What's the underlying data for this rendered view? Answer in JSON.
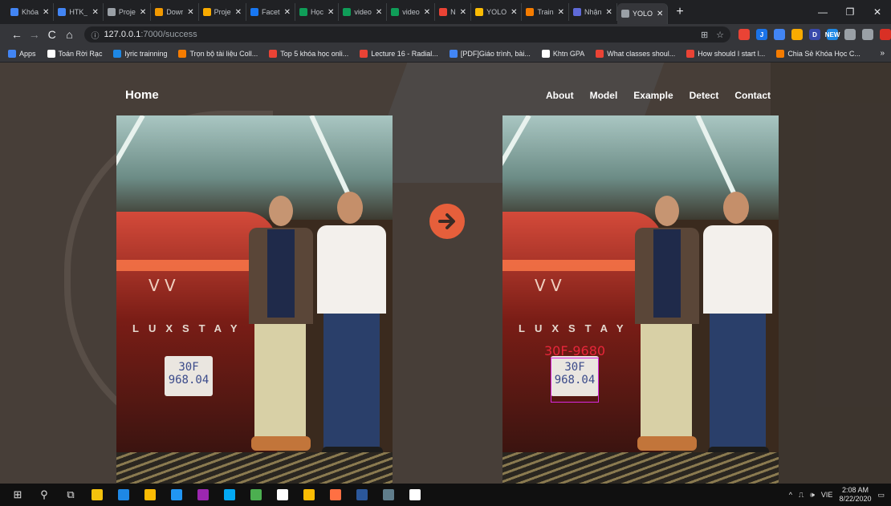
{
  "browser": {
    "tabs": [
      {
        "label": "Khóa",
        "color": "#4285f4"
      },
      {
        "label": "HTK_",
        "color": "#4285f4"
      },
      {
        "label": "Proje",
        "color": "#9aa0a6"
      },
      {
        "label": "Dowr",
        "color": "#f29900"
      },
      {
        "label": "Proje",
        "color": "#f9ab00"
      },
      {
        "label": "Facet",
        "color": "#1877f2"
      },
      {
        "label": "Học",
        "color": "#0f9d58"
      },
      {
        "label": "video",
        "color": "#0f9d58"
      },
      {
        "label": "video",
        "color": "#0f9d58"
      },
      {
        "label": "N",
        "color": "#ea4335"
      },
      {
        "label": "YOLO",
        "color": "#fbbc04"
      },
      {
        "label": "Train",
        "color": "#f57c00"
      },
      {
        "label": "Nhận",
        "color": "#5f6ad8"
      },
      {
        "label": "YOLO",
        "color": "#9aa0a6",
        "active": true
      }
    ],
    "new_tab": "+",
    "window_controls": {
      "minimize": "—",
      "maximize": "❐",
      "close": "✕"
    },
    "nav": {
      "back": "←",
      "forward": "→",
      "reload": "C",
      "home": "⌂"
    },
    "address": {
      "info_icon": "ⓘ",
      "host": "127.0.0.1",
      "path": ":7000/success"
    },
    "omni_icons": {
      "translate": "⊞",
      "bookmark_star": "☆"
    },
    "extensions": [
      {
        "label": "",
        "color": "#ea4335"
      },
      {
        "label": "J",
        "color": "#1a73e8"
      },
      {
        "label": "",
        "color": "#4285f4"
      },
      {
        "label": "",
        "color": "#f9ab00"
      },
      {
        "label": "D",
        "color": "#3949ab"
      },
      {
        "label": "NEW",
        "color": "#1e88e5"
      },
      {
        "label": "",
        "color": "#9aa0a6"
      },
      {
        "label": "",
        "color": "#9aa0a6"
      },
      {
        "label": "",
        "color": "#d93025"
      }
    ],
    "bookmarks": [
      {
        "label": "Apps",
        "color": "#4285f4"
      },
      {
        "label": "Toán Rời Rạc",
        "color": "#ffffff"
      },
      {
        "label": "lyric trainning",
        "color": "#1e88e5"
      },
      {
        "label": "Trọn bộ tài liệu Coll...",
        "color": "#f57c00"
      },
      {
        "label": "Top 5 khóa học onli...",
        "color": "#ea4335"
      },
      {
        "label": "Lecture 16 - Radial...",
        "color": "#ea4335"
      },
      {
        "label": "[PDF]Giáo trình, bài...",
        "color": "#4285f4"
      },
      {
        "label": "Khtn GPA",
        "color": "#ffffff"
      },
      {
        "label": "What classes shoul...",
        "color": "#ea4335"
      },
      {
        "label": "How should I start l...",
        "color": "#ea4335"
      },
      {
        "label": "Chia Sẻ Khóa Học C...",
        "color": "#f57c00"
      }
    ],
    "bookmarks_more": "»"
  },
  "site": {
    "brand": "Home",
    "menu": [
      "About",
      "Model",
      "Example",
      "Detect",
      "Contact"
    ],
    "arrow_icon": "arrow-right-icon",
    "accent": "#e65f3b"
  },
  "photo": {
    "car_brand": "LUXSTAY",
    "plate_line1": "30F",
    "plate_line2": "968.04"
  },
  "detection": {
    "label": "30F-9680",
    "box_color": "#d928e0",
    "label_color": "#e8263a"
  },
  "taskbar": {
    "start": "⊞",
    "search": "⚲",
    "task_view": "⧉",
    "apps": [
      {
        "name": "file-explorer",
        "color": "#f4c20d"
      },
      {
        "name": "mail",
        "color": "#1e88e5"
      },
      {
        "name": "sticky",
        "color": "#fbbc04"
      },
      {
        "name": "edge",
        "color": "#2196f3"
      },
      {
        "name": "app5",
        "color": "#9c27b0"
      },
      {
        "name": "app6",
        "color": "#03a9f4"
      },
      {
        "name": "app7",
        "color": "#4caf50"
      },
      {
        "name": "app8",
        "color": "#ffffff"
      },
      {
        "name": "chrome",
        "color": "#fbbc04"
      },
      {
        "name": "app10",
        "color": "#ff7043"
      },
      {
        "name": "word",
        "color": "#2b579a"
      },
      {
        "name": "app12",
        "color": "#607d8b"
      },
      {
        "name": "file",
        "color": "#ffffff"
      }
    ],
    "tray": {
      "chevron": "^",
      "network": "⎍",
      "volume": "🕪",
      "lang": "VIE",
      "time": "2:08 AM",
      "date": "8/22/2020",
      "notification": "▭"
    }
  }
}
